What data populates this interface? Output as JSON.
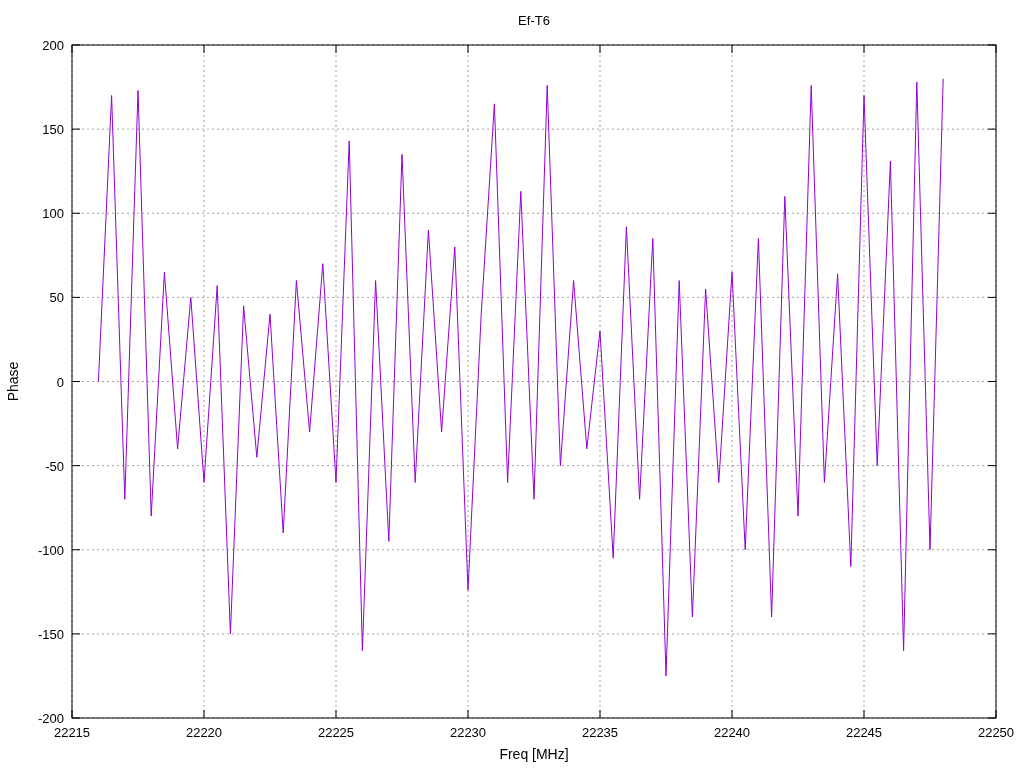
{
  "chart_data": {
    "type": "line",
    "grid": true,
    "title": "Ef-T6",
    "xlabel": "Freq [MHz]",
    "ylabel": "Phase",
    "xlim": [
      22215,
      22250
    ],
    "ylim": [
      -200,
      200
    ],
    "xticks": [
      22215,
      22220,
      22225,
      22230,
      22235,
      22240,
      22245,
      22250
    ],
    "yticks": [
      -200,
      -150,
      -100,
      -50,
      0,
      50,
      100,
      150,
      200
    ],
    "x": [
      22216,
      22216.5,
      22217,
      22217.5,
      22218,
      22218.5,
      22219,
      22219.5,
      22220,
      22220.5,
      22221,
      22221.5,
      22222,
      22222.5,
      22223,
      22223.5,
      22224,
      22224.5,
      22225,
      22225.5,
      22226,
      22226.5,
      22227,
      22227.5,
      22228,
      22228.5,
      22229,
      22229.5,
      22230,
      22230.5,
      22231,
      22231.5,
      22232,
      22232.5,
      22233,
      22233.5,
      22234,
      22234.5,
      22235,
      22235.5,
      22236,
      22236.5,
      22237,
      22237.5,
      22238,
      22238.5,
      22239,
      22239.5,
      22240,
      22240.5,
      22241,
      22241.5,
      22242,
      22242.5,
      22243,
      22243.5,
      22244,
      22244.5,
      22245,
      22245.5,
      22246,
      22246.5,
      22247,
      22247.5,
      22248
    ],
    "series": [
      {
        "color": "#9400d3",
        "values": [
          0,
          170,
          -70,
          173,
          -80,
          65,
          -40,
          50,
          -60,
          57,
          -150,
          45,
          -45,
          40,
          -90,
          60,
          -30,
          70,
          -60,
          143,
          -160,
          60,
          -95,
          135,
          -60,
          90,
          -30,
          80,
          -124,
          40,
          165,
          -60,
          113,
          -70,
          176,
          -50,
          60,
          -40,
          30,
          -105,
          92,
          -70,
          85,
          -175,
          60,
          -140,
          55,
          -60,
          65,
          -100,
          85,
          -140,
          110,
          -80,
          176,
          -60,
          64,
          -110,
          170,
          -50,
          131,
          -160,
          178,
          -100,
          180
        ]
      }
    ]
  }
}
